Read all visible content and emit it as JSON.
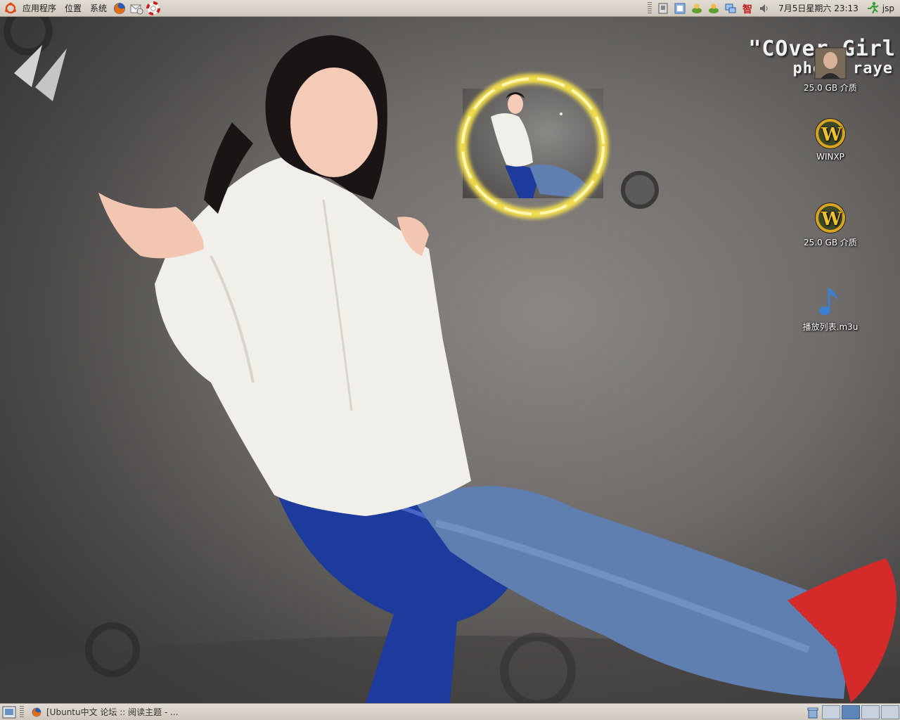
{
  "top_panel": {
    "menus": [
      "应用程序",
      "位置",
      "系统"
    ],
    "launchers": [
      "firefox-icon",
      "mail-icon",
      "help-icon"
    ],
    "tray_icons": [
      "drive-icon",
      "network-manager-icon",
      "pidgin-icon",
      "pidgin-status-icon",
      "network-icon",
      "ime-icon",
      "volume-icon"
    ],
    "clock": "7月5日星期六 23:13",
    "user": "jsp"
  },
  "wallpaper": {
    "title_line1": "\"COver Girl",
    "title_line2": "photo raye"
  },
  "desktop_icons": [
    {
      "label": "25.0 GB 介质",
      "icon": "drive-photo-icon"
    },
    {
      "label": "WINXP",
      "icon": "wow-drive-icon"
    },
    {
      "label": "25.0 GB 介质",
      "icon": "wow-drive-icon"
    },
    {
      "label": "播放列表.m3u",
      "icon": "music-note-icon"
    }
  ],
  "bottom_panel": {
    "task": "[Ubuntu中文 论坛 :: 阅读主题 - ...",
    "workspaces": 4,
    "active_workspace": 2
  },
  "colors": {
    "panel": "#d8d2c8",
    "workspace_active": "#5b86b7",
    "ring_glow": "#ffe94a"
  }
}
